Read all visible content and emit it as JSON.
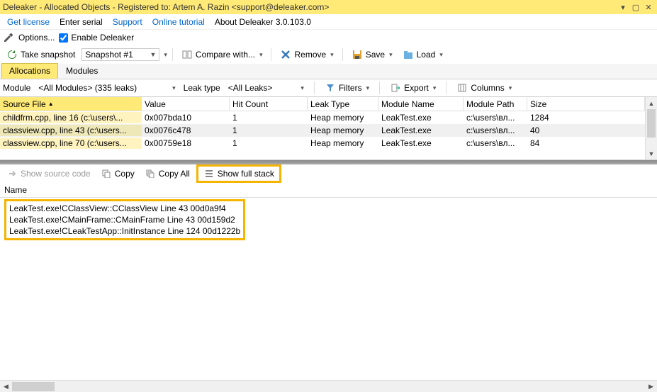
{
  "title": "Deleaker - Allocated Objects - Registered to: Artem A. Razin <support@deleaker.com>",
  "menu": {
    "get_license": "Get license",
    "enter_serial": "Enter serial",
    "support": "Support",
    "online_tutorial": "Online tutorial",
    "about": "About Deleaker 3.0.103.0"
  },
  "optionsbar": {
    "options": "Options...",
    "enable": "Enable Deleaker"
  },
  "toolbar": {
    "take_snapshot": "Take snapshot",
    "snapshot_selected": "Snapshot #1",
    "compare": "Compare with...",
    "remove": "Remove",
    "save": "Save",
    "load": "Load"
  },
  "tabs": {
    "allocations": "Allocations",
    "modules": "Modules"
  },
  "filterbar": {
    "module_label": "Module",
    "module_value": "<All Modules> (335 leaks)",
    "leaktype_label": "Leak type",
    "leaktype_value": "<All Leaks>",
    "filters": "Filters",
    "export": "Export",
    "columns": "Columns"
  },
  "grid": {
    "headers": [
      "Source File",
      "Value",
      "Hit Count",
      "Leak Type",
      "Module Name",
      "Module Path",
      "Size"
    ],
    "sort_indicator": "▲",
    "rows": [
      {
        "src": "childfrm.cpp, line 16 (c:\\users\\...",
        "value": "0x007bda10",
        "hit": "1",
        "type": "Heap memory",
        "mod": "LeakTest.exe",
        "path": "c:\\users\\вл...",
        "size": "1284"
      },
      {
        "src": "classview.cpp, line 43 (c:\\users...",
        "value": "0x0076c478",
        "hit": "1",
        "type": "Heap memory",
        "mod": "LeakTest.exe",
        "path": "c:\\users\\вл...",
        "size": "40"
      },
      {
        "src": "classview.cpp, line 70 (c:\\users...",
        "value": "0x00759e18",
        "hit": "1",
        "type": "Heap memory",
        "mod": "LeakTest.exe",
        "path": "c:\\users\\вл...",
        "size": "84"
      }
    ]
  },
  "lower_toolbar": {
    "show_source": "Show source code",
    "copy": "Copy",
    "copy_all": "Copy All",
    "show_full_stack": "Show full stack"
  },
  "stack": {
    "header": "Name",
    "lines": [
      "LeakTest.exe!CClassView::CClassView Line 43 00d0a9f4",
      "LeakTest.exe!CMainFrame::CMainFrame Line 43 00d159d2",
      "LeakTest.exe!CLeakTestApp::InitInstance Line 124 00d1222b"
    ]
  }
}
